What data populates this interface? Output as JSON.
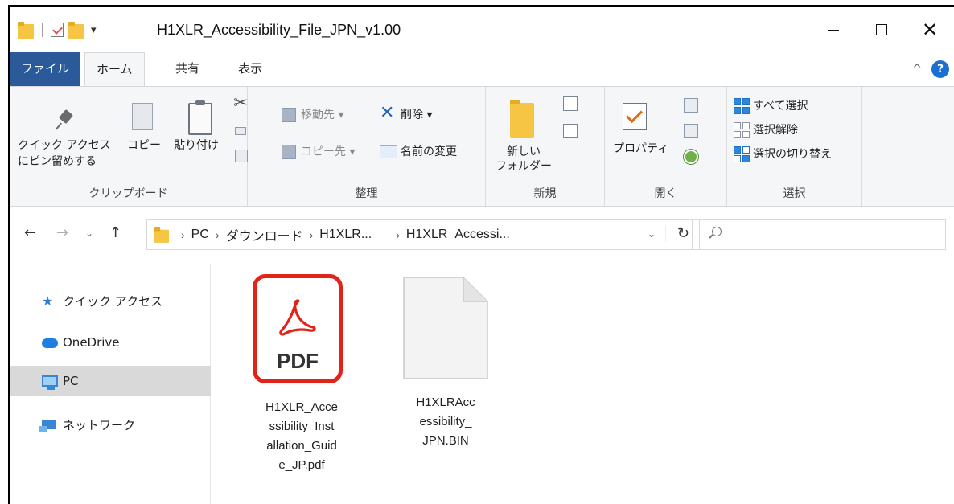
{
  "window": {
    "title": "H1XLR_Accessibility_File_JPN_v1.00",
    "close_glyph": "✕"
  },
  "tabs": {
    "file": "ファイル",
    "home": "ホーム",
    "share": "共有",
    "view": "表示"
  },
  "ribbon": {
    "clipboard": {
      "pin_line1": "クイック アクセス",
      "pin_line2": "にピン留めする",
      "copy": "コピー",
      "paste": "貼り付け",
      "label": "クリップボード"
    },
    "organize": {
      "move_to": "移動先 ▾",
      "copy_to": "コピー先 ▾",
      "delete": "削除 ▾",
      "rename": "名前の変更",
      "label": "整理"
    },
    "new": {
      "new_folder_line1": "新しい",
      "new_folder_line2": "フォルダー",
      "label": "新規"
    },
    "open": {
      "properties": "プロパティ",
      "label": "開く"
    },
    "select": {
      "select_all": "すべて選択",
      "select_none": "選択解除",
      "invert": "選択の切り替え",
      "label": "選択"
    }
  },
  "address": {
    "crumbs": [
      "PC",
      "ダウンロード",
      "H1XLR...",
      "H1XLR_Accessi..."
    ],
    "search_placeholder": ""
  },
  "navpane": {
    "items": [
      "クイック アクセス",
      "OneDrive",
      "PC",
      "ネットワーク"
    ],
    "selected": "PC"
  },
  "files": [
    {
      "name": "H1XLR_Accessibility_Installation_Guide_JP.pdf",
      "lines": [
        "H1XLR_Acce",
        "ssibility_Inst",
        "allation_Guid",
        "e_JP.pdf"
      ],
      "icon": "pdf-icon",
      "badge": "PDF"
    },
    {
      "name": "H1XLRAccessibility_JPN.BIN",
      "lines": [
        "H1XLRAcc",
        "essibility_",
        "JPN.BIN"
      ],
      "icon": "blank-file-icon"
    }
  ],
  "colors": {
    "accent": "#2a5a9a",
    "pdf_red": "#e2231a",
    "folder": "#f6c544",
    "selected_nav": "#d9d9d9"
  }
}
